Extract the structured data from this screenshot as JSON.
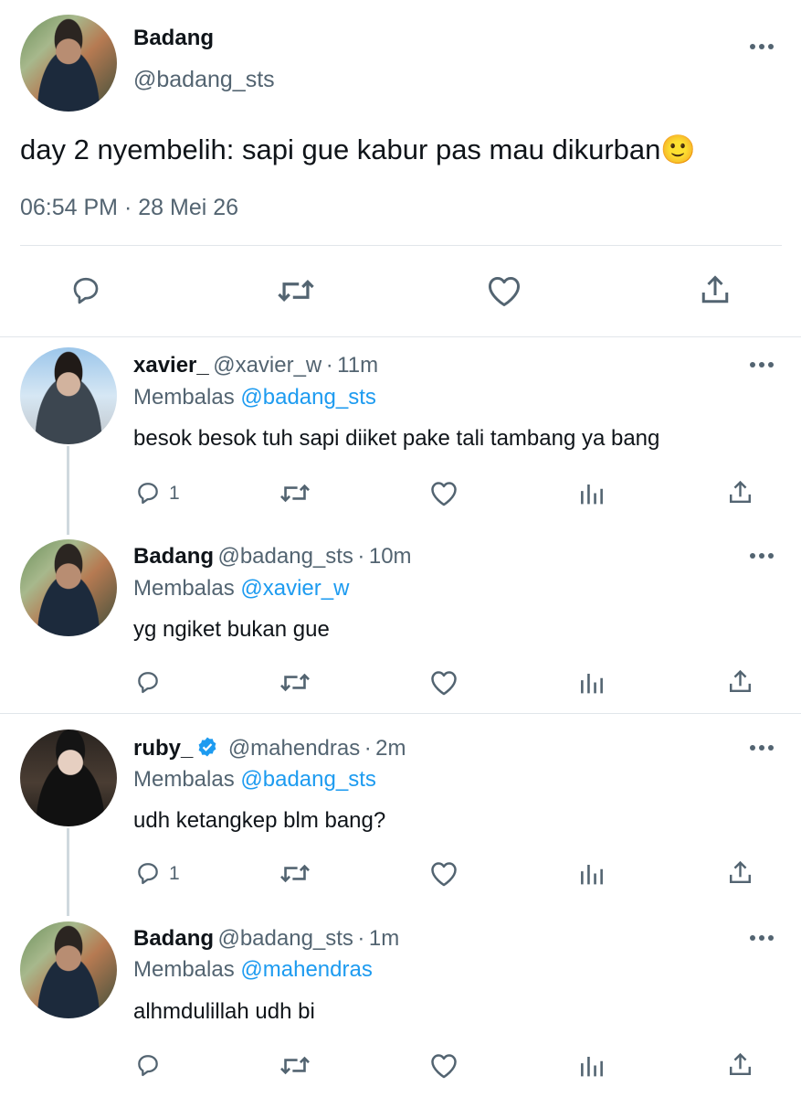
{
  "main_tweet": {
    "name": "Badang",
    "handle": "@badang_sts",
    "text": "day 2 nyembelih: sapi gue kabur pas mau dikurban",
    "emoji": "🙂",
    "time": "06:54 PM",
    "separator": "·",
    "date": "28 Mei 26",
    "actions": [
      "reply-icon",
      "retweet-icon",
      "like-icon",
      "share-icon"
    ]
  },
  "replies": [
    {
      "name": "xavier_",
      "handle": "@xavier_w",
      "separator": "·",
      "time": "11m",
      "reply_prefix": "Membalas",
      "reply_to": "@badang_sts",
      "text": "besok besok tuh sapi diiket pake tali tambang ya bang",
      "reply_count": "1"
    },
    {
      "name": "Badang",
      "handle": "@badang_sts",
      "separator": "·",
      "time": "10m",
      "reply_prefix": "Membalas",
      "reply_to": "@xavier_w",
      "text": "yg ngiket bukan gue",
      "reply_count": ""
    },
    {
      "name": "ruby_",
      "verified": true,
      "handle": "@mahendras",
      "separator": "·",
      "time": "2m",
      "reply_prefix": "Membalas",
      "reply_to": "@badang_sts",
      "text": "udh ketangkep blm bang?",
      "reply_count": "1"
    },
    {
      "name": "Badang",
      "handle": "@badang_sts",
      "separator": "·",
      "time": "1m",
      "reply_prefix": "Membalas",
      "reply_to": "@mahendras",
      "text": "alhmdulillah udh bi",
      "reply_count": ""
    }
  ],
  "colors": {
    "text": "#0f1419",
    "secondary": "#536471",
    "link": "#1d9bf0",
    "verified": "#1d9bf0",
    "divider": "#e1e6ea"
  }
}
